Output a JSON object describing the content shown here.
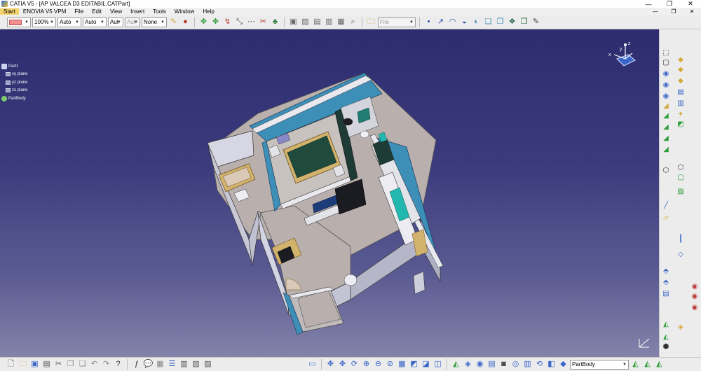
{
  "window": {
    "title": "CATIA V5 - [AP VALCEA D3 EDITABIL.CATPart]",
    "controls": [
      "—",
      "❐",
      "✕"
    ]
  },
  "menubar": {
    "items": [
      "Start",
      "ENOVIA V5 VPM",
      "File",
      "Edit",
      "View",
      "Insert",
      "Tools",
      "Window",
      "Help"
    ],
    "doc_controls": [
      "—",
      "❐",
      "✕"
    ]
  },
  "toolbar": {
    "zoom": "100%",
    "line_type": "Auto",
    "line_weight": "Auto",
    "point_style": "Aut",
    "layer_style": "Aut",
    "layer": "None",
    "filter": "File"
  },
  "spec_tree": {
    "root": "Part1",
    "planes": [
      "xy plane",
      "yz plane",
      "zx plane"
    ],
    "body": "PartBody"
  },
  "compass": {
    "axis_x": "x",
    "axis_y": "y",
    "axis_z": "z"
  },
  "statusbar": {
    "current_body": "PartBody"
  },
  "colors": {
    "viewport_top": "#2c2c6e",
    "viewport_bottom": "#8383aa",
    "wall": "#c8c8cf",
    "floor": "#b5aca8",
    "bed": "#1f4a3c",
    "swatch": "#f28e8e"
  }
}
